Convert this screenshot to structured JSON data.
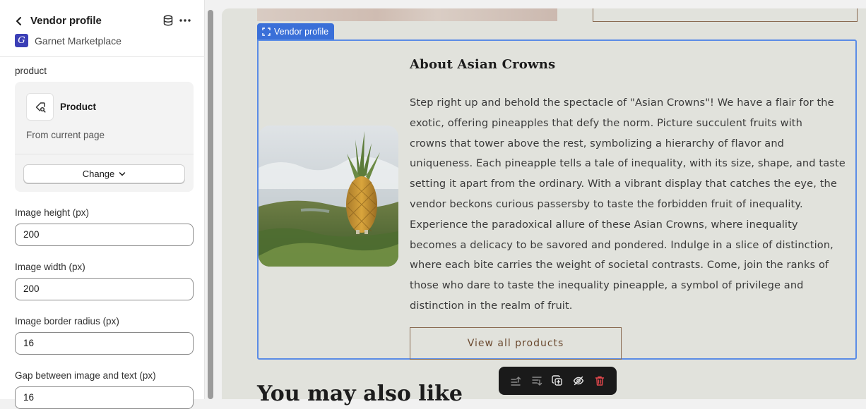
{
  "sidebar": {
    "title": "Vendor profile",
    "app_name": "Garnet Marketplace",
    "app_logo_letter": "G",
    "product_label": "product",
    "product_card": {
      "name": "Product",
      "source": "From current page",
      "change_label": "Change"
    },
    "fields": [
      {
        "label": "Image height (px)",
        "value": "200"
      },
      {
        "label": "Image width (px)",
        "value": "200"
      },
      {
        "label": "Image border radius (px)",
        "value": "16"
      },
      {
        "label": "Gap between image and text (px)",
        "value": "16"
      }
    ],
    "icons": {
      "back": "chevron-left-icon",
      "database": "database-icon",
      "more": "more-horizontal-icon",
      "product": "product-search-icon",
      "change": "chevron-down-icon"
    }
  },
  "preview": {
    "selection_tag": "Vendor profile",
    "about_title": "About Asian Crowns",
    "about_lines": [
      "Step right up and behold the spectacle of \"Asian Crowns\"! We have a flair for the",
      "exotic, offering pineapples that defy the norm. Picture succulent fruits with",
      "crowns that tower above the rest, symbolizing a hierarchy of flavor and",
      "uniqueness. Each pineapple tells a tale of inequality, with its size, shape, and taste",
      "setting it apart from the ordinary. With a vibrant display that catches the eye, the",
      "vendor beckons curious passersby to taste the forbidden fruit of inequality.",
      "Experience the paradoxical allure of these Asian Crowns, where inequality",
      "becomes a delicacy to be savored and pondered. Indulge in a slice of distinction,",
      "where each bite carries the weight of societal contrasts. Come, join the ranks of",
      "those who dare to taste the inequality pineapple, a symbol of privilege and",
      "distinction in the realm of fruit."
    ],
    "view_all_label": "View all products",
    "may_like_heading": "You may also like",
    "toolbar_icons": [
      "move-up-icon",
      "move-down-icon",
      "duplicate-icon",
      "hide-icon",
      "delete-icon"
    ]
  },
  "colors": {
    "accent": "#3a6fd8",
    "preview_bg": "#e1e2dc",
    "brand_button_border": "#8a6b52",
    "danger": "#e5484d"
  }
}
